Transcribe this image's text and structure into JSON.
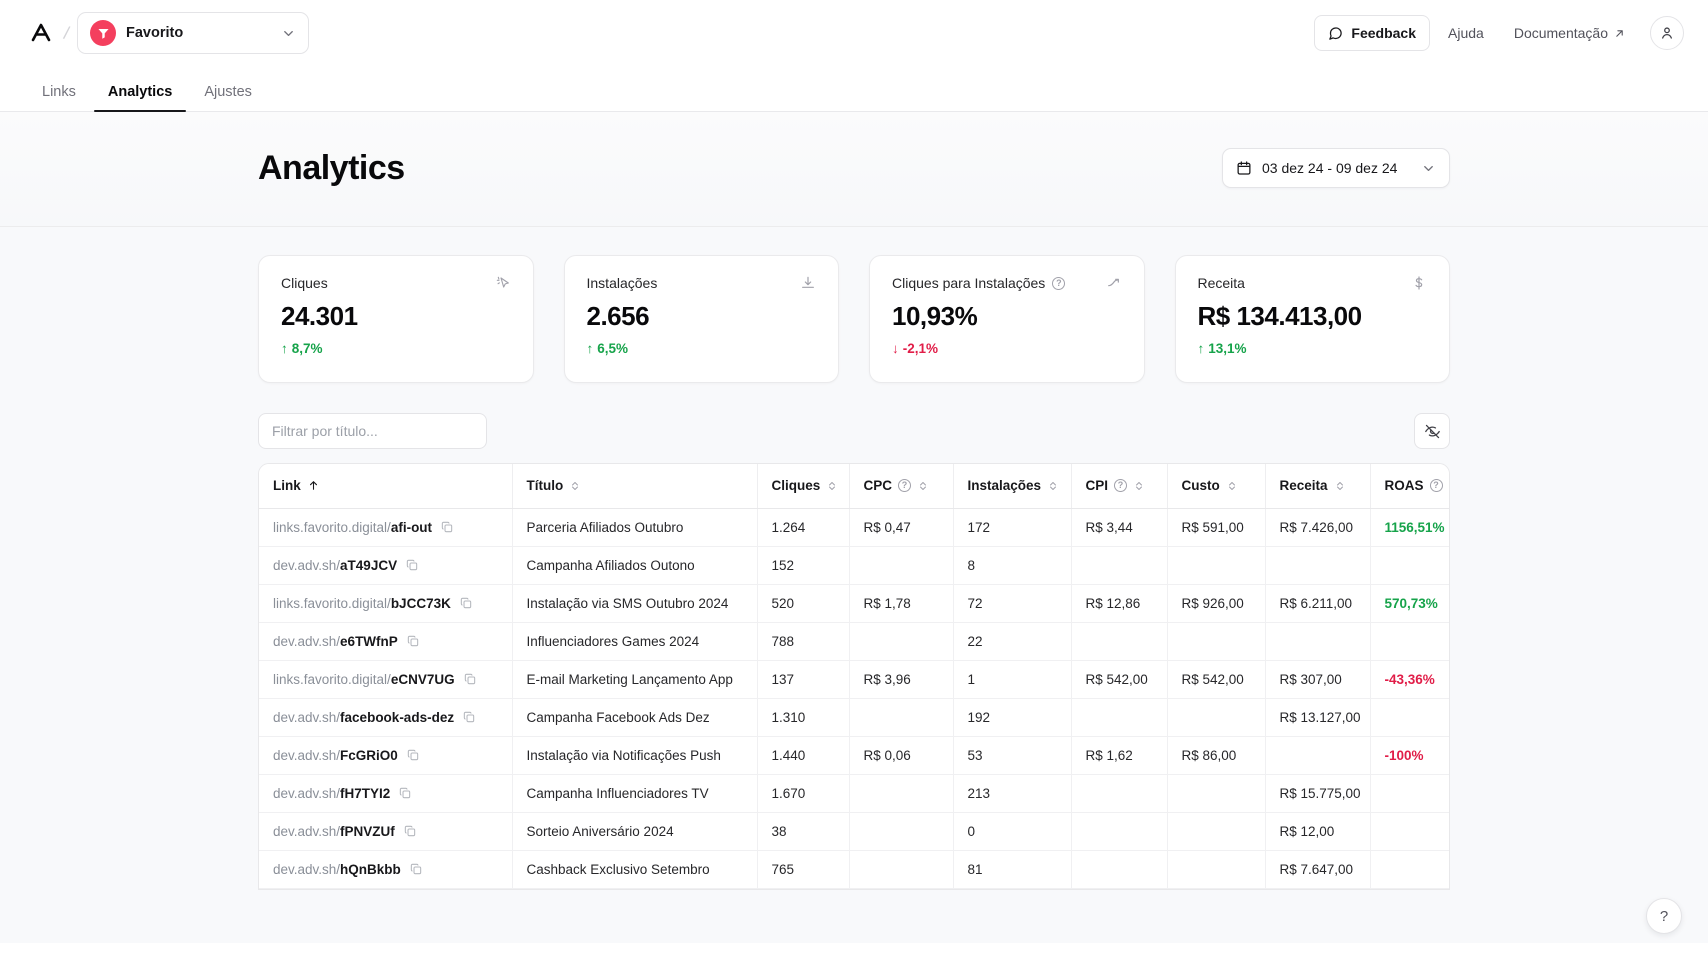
{
  "header": {
    "logo_icon": "app-logo-icon",
    "workspace": {
      "name": "Favorito",
      "avatar_icon": "workspace-avatar-icon",
      "chevron_icon": "chevron-down-icon"
    },
    "feedback_label": "Feedback",
    "feedback_icon": "message-square-icon",
    "help_label": "Ajuda",
    "docs_label": "Documentação",
    "docs_icon": "external-link-arrow-icon",
    "account_icon": "user-icon"
  },
  "tabs": [
    {
      "label": "Links",
      "active": false
    },
    {
      "label": "Analytics",
      "active": true
    },
    {
      "label": "Ajustes",
      "active": false
    }
  ],
  "page": {
    "title": "Analytics",
    "date_range": "03 dez 24 - 09 dez 24",
    "calendar_icon": "calendar-icon",
    "date_chevron_icon": "chevron-down-icon"
  },
  "kpis": [
    {
      "label": "Cliques",
      "value": "24.301",
      "delta": "8,7%",
      "direction": "up",
      "icon": "cursor-click-icon",
      "has_info": false
    },
    {
      "label": "Instalações",
      "value": "2.656",
      "delta": "6,5%",
      "direction": "up",
      "icon": "download-icon",
      "has_info": false
    },
    {
      "label": "Cliques para Instalações",
      "value": "10,93%",
      "delta": "-2,1%",
      "direction": "down",
      "icon": "trend-arrow-icon",
      "has_info": true
    },
    {
      "label": "Receita",
      "value": "R$ 134.413,00",
      "delta": "13,1%",
      "direction": "up",
      "icon": "dollar-icon",
      "has_info": false
    }
  ],
  "filter": {
    "placeholder": "Filtrar por título...",
    "value": "",
    "toggle_columns_icon": "eye-off-icon"
  },
  "table": {
    "columns": [
      {
        "label": "Link",
        "sort_icon": "sort-asc-arrow-icon",
        "info": false
      },
      {
        "label": "Título",
        "sort_icon": "sort-both-icon",
        "info": false
      },
      {
        "label": "Cliques",
        "sort_icon": "sort-both-icon",
        "info": false
      },
      {
        "label": "CPC",
        "sort_icon": "sort-both-icon",
        "info": true
      },
      {
        "label": "Instalações",
        "sort_icon": "sort-both-icon",
        "info": false
      },
      {
        "label": "CPI",
        "sort_icon": "sort-both-icon",
        "info": true
      },
      {
        "label": "Custo",
        "sort_icon": "sort-both-icon",
        "info": false
      },
      {
        "label": "Receita",
        "sort_icon": "sort-both-icon",
        "info": false
      },
      {
        "label": "ROAS",
        "sort_icon": "",
        "info": true
      }
    ],
    "rows": [
      {
        "domain": "links.favorito.digital/",
        "slug": "afi-out",
        "title": "Parceria Afiliados Outubro",
        "cliques": "1.264",
        "cpc": "R$ 0,47",
        "instalacoes": "172",
        "cpi": "R$ 3,44",
        "custo": "R$ 591,00",
        "receita": "R$ 7.426,00",
        "roas": "1156,51%",
        "roas_sign": "pos"
      },
      {
        "domain": "dev.adv.sh/",
        "slug": "aT49JCV",
        "title": "Campanha Afiliados Outono",
        "cliques": "152",
        "cpc": "",
        "instalacoes": "8",
        "cpi": "",
        "custo": "",
        "receita": "",
        "roas": "",
        "roas_sign": ""
      },
      {
        "domain": "links.favorito.digital/",
        "slug": "bJCC73K",
        "title": "Instalação via SMS Outubro 2024",
        "cliques": "520",
        "cpc": "R$ 1,78",
        "instalacoes": "72",
        "cpi": "R$ 12,86",
        "custo": "R$ 926,00",
        "receita": "R$ 6.211,00",
        "roas": "570,73%",
        "roas_sign": "pos"
      },
      {
        "domain": "dev.adv.sh/",
        "slug": "e6TWfnP",
        "title": "Influenciadores Games 2024",
        "cliques": "788",
        "cpc": "",
        "instalacoes": "22",
        "cpi": "",
        "custo": "",
        "receita": "",
        "roas": "",
        "roas_sign": ""
      },
      {
        "domain": "links.favorito.digital/",
        "slug": "eCNV7UG",
        "title": "E-mail Marketing Lançamento App",
        "cliques": "137",
        "cpc": "R$ 3,96",
        "instalacoes": "1",
        "cpi": "R$ 542,00",
        "custo": "R$ 542,00",
        "receita": "R$ 307,00",
        "roas": "-43,36%",
        "roas_sign": "neg"
      },
      {
        "domain": "dev.adv.sh/",
        "slug": "facebook-ads-dez",
        "title": "Campanha Facebook Ads Dez",
        "cliques": "1.310",
        "cpc": "",
        "instalacoes": "192",
        "cpi": "",
        "custo": "",
        "receita": "R$ 13.127,00",
        "roas": "",
        "roas_sign": ""
      },
      {
        "domain": "dev.adv.sh/",
        "slug": "FcGRiO0",
        "title": "Instalação via Notificações Push",
        "cliques": "1.440",
        "cpc": "R$ 0,06",
        "instalacoes": "53",
        "cpi": "R$ 1,62",
        "custo": "R$ 86,00",
        "receita": "",
        "roas": "-100%",
        "roas_sign": "neg"
      },
      {
        "domain": "dev.adv.sh/",
        "slug": "fH7TYI2",
        "title": "Campanha Influenciadores TV",
        "cliques": "1.670",
        "cpc": "",
        "instalacoes": "213",
        "cpi": "",
        "custo": "",
        "receita": "R$ 15.775,00",
        "roas": "",
        "roas_sign": ""
      },
      {
        "domain": "dev.adv.sh/",
        "slug": "fPNVZUf",
        "title": "Sorteio Aniversário 2024",
        "cliques": "38",
        "cpc": "",
        "instalacoes": "0",
        "cpi": "",
        "custo": "",
        "receita": "R$ 12,00",
        "roas": "",
        "roas_sign": ""
      },
      {
        "domain": "dev.adv.sh/",
        "slug": "hQnBkbb",
        "title": "Cashback Exclusivo Setembro",
        "cliques": "765",
        "cpc": "",
        "instalacoes": "81",
        "cpi": "",
        "custo": "",
        "receita": "R$ 7.647,00",
        "roas": "",
        "roas_sign": ""
      }
    ]
  },
  "help_fab": {
    "label": "?"
  }
}
